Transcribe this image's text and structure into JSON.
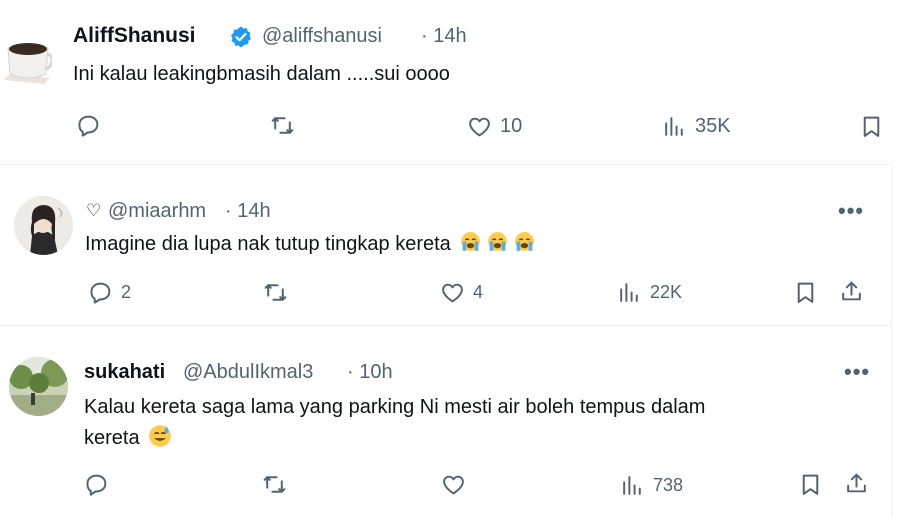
{
  "tweets": [
    {
      "display_name": "AliffShanusi",
      "handle": "@aliffshanusi",
      "time": "· 14h",
      "text": "Ini kalau leakingbmasih dalam .....sui oooo",
      "likes": "10",
      "views": "35K"
    },
    {
      "heart_prefix": "♡",
      "handle": "@miaarhm",
      "time": "· 14h",
      "text": "Imagine dia lupa nak tutup tingkap kereta",
      "replies": "2",
      "likes": "4",
      "views": "22K",
      "more": "•••"
    },
    {
      "display_name": "sukahati",
      "handle": "@AbdulIkmal3",
      "time": "· 10h",
      "text_line1": "Kalau kereta saga lama yang parking Ni mesti air boleh tempus dalam",
      "text_line2": "kereta",
      "views": "738",
      "more": "•••"
    }
  ],
  "icons": [
    "reply-icon",
    "retweet-icon",
    "like-icon",
    "views-icon",
    "bookmark-icon",
    "share-icon",
    "verified-badge-icon",
    "crying-emoji",
    "sweat-smile-emoji"
  ],
  "colors": {
    "verified": "#1d9bf0",
    "muted": "#536471",
    "text": "#0f1419",
    "divider": "#eff3f4"
  }
}
